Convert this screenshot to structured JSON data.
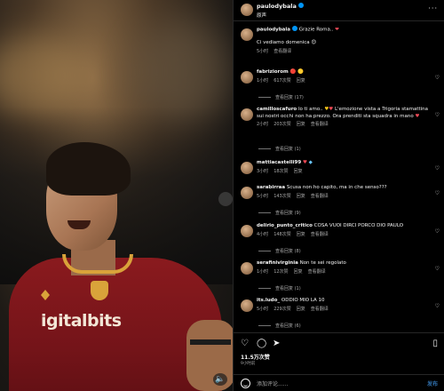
{
  "post_author": {
    "username": "paulodybala",
    "subtitle": "原声"
  },
  "caption": {
    "username": "paulodybala",
    "text_line1": "Grazie Roma..",
    "text_line2": "Ci vediamo domenica",
    "time": "5小时",
    "translate": "查看翻译"
  },
  "comments": [
    {
      "username": "fabriziorom",
      "text": "",
      "time": "1小时",
      "likes": "617次赞",
      "reply": "回复",
      "translate": "",
      "replies": "查看回复 (17)"
    },
    {
      "username": "camilloscafuro",
      "text": "Io ti amo..",
      "text_cont": "L'emozione vista a Trigoria stamattina sui nostri occhi non ha prezzo. Ora prenditi sta squadra in mano",
      "time": "2小时",
      "likes": "203次赞",
      "reply": "回复",
      "translate": "查看翻译",
      "replies": "查看回复 (1)"
    },
    {
      "username": "mattiacastelli99",
      "text": "",
      "time": "3小时",
      "likes": "18次赞",
      "reply": "回复",
      "translate": "",
      "replies": ""
    },
    {
      "username": "sarabirraa",
      "text": "Scusa non ho capito, ma in che senso???",
      "time": "5小时",
      "likes": "143次赞",
      "reply": "回复",
      "translate": "查看翻译",
      "replies": "查看回复 (9)"
    },
    {
      "username": "delirio_punto_critico",
      "text": "COSA VUOI DIRCI PORCO DIO PAULO",
      "time": "4小时",
      "likes": "148次赞",
      "reply": "回复",
      "translate": "查看翻译",
      "replies": "查看回复 (8)"
    },
    {
      "username": "serafinivirginia",
      "text": "Non te sei regolato",
      "time": "1小时",
      "likes": "12次赞",
      "reply": "回复",
      "translate": "查看翻译",
      "replies": "查看回复 (1)"
    },
    {
      "username": "its.ludo_",
      "text": "ODDIO MIO LA 10",
      "time": "5小时",
      "likes": "229次赞",
      "reply": "回复",
      "translate": "查看翻译",
      "replies": "查看回复 (6)"
    }
  ],
  "footer": {
    "likes": "11.5万次赞",
    "time": "9小时前",
    "add_comment_placeholder": "添加评论......",
    "post_label": "发布"
  },
  "media": {
    "sponsor_text": "igitalbits"
  },
  "colors": {
    "accent": "#0095f6",
    "jersey": "#8a1a1e",
    "background": "#000000"
  }
}
